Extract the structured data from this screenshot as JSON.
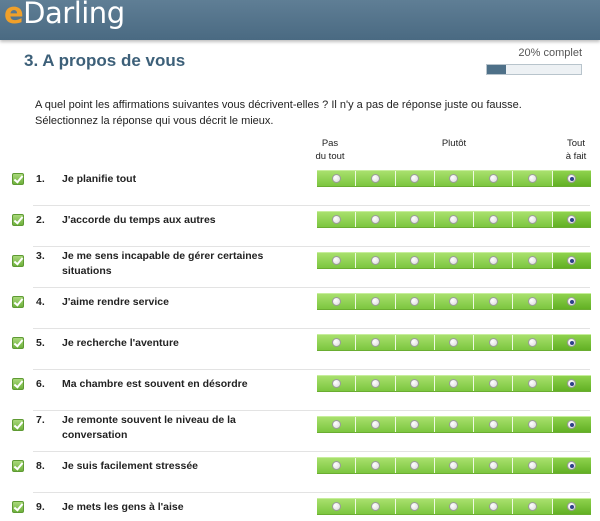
{
  "header": {
    "logo_e": "e",
    "logo_rest": "Darling"
  },
  "page_title": "3. A propos de vous",
  "progress": {
    "label": "20% complet",
    "value": 0.2
  },
  "intro": {
    "line1": "A quel point les affirmations suivantes vous décrivent-elles ? Il n'y a pas de réponse juste ou fausse.",
    "line2": "Sélectionnez la réponse qui vous décrit le mieux."
  },
  "scale_labels": {
    "left_line1": "Pas",
    "left_line2": "du tout",
    "mid": "Plutôt",
    "right_line1": "Tout",
    "right_line2": "à fait"
  },
  "questions": [
    {
      "num": "1.",
      "text": "Je planifie tout",
      "selected": 7
    },
    {
      "num": "2.",
      "text": "J'accorde du temps aux autres",
      "selected": 7
    },
    {
      "num": "3.",
      "text": "Je me sens incapable de gérer certaines situations",
      "selected": 7
    },
    {
      "num": "4.",
      "text": "J'aime rendre service",
      "selected": 7
    },
    {
      "num": "5.",
      "text": "Je recherche l'aventure",
      "selected": 7
    },
    {
      "num": "6.",
      "text": "Ma chambre est souvent en désordre",
      "selected": 7
    },
    {
      "num": "7.",
      "text": "Je remonte souvent le niveau de la conversation",
      "selected": 7
    },
    {
      "num": "8.",
      "text": "Je suis facilement stressée",
      "selected": 7
    },
    {
      "num": "9.",
      "text": "Je mets les gens à l'aise",
      "selected": 7
    }
  ]
}
